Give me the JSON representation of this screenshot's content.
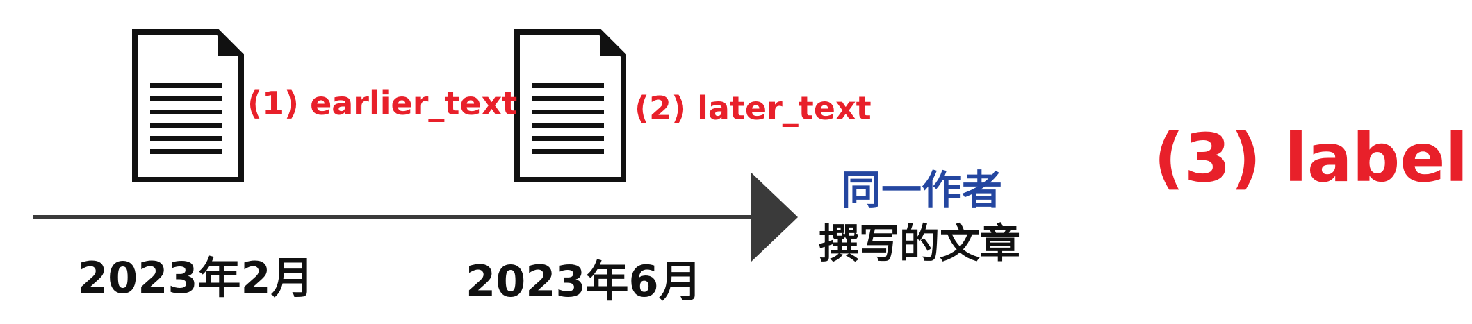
{
  "documents": [
    {
      "label": "(1) earlier_text",
      "date": "2023年2月"
    },
    {
      "label": "(2) later_text",
      "date": "2023年6月"
    }
  ],
  "caption": {
    "line1": "同一作者",
    "line2": "撰写的文章"
  },
  "result_label": "(3) label",
  "colors": {
    "label_red": "#e8202a",
    "caption_blue": "#2446a0",
    "timeline": "#3a3a3a",
    "text_dark": "#111111"
  },
  "icons": {
    "document": "document-icon",
    "arrow": "arrow-head-icon"
  }
}
